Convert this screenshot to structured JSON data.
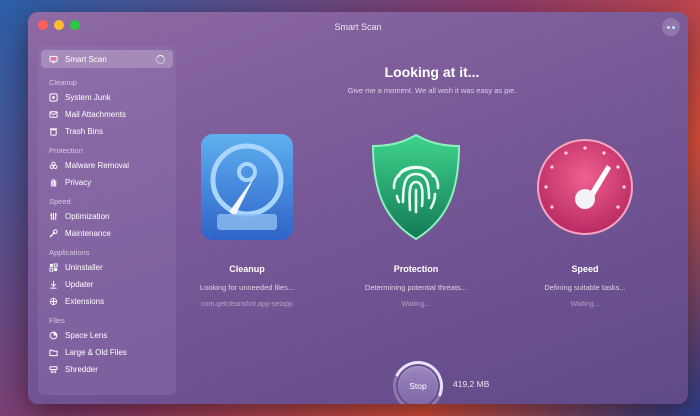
{
  "window": {
    "title": "Smart Scan"
  },
  "sidebar": {
    "active": {
      "label": "Smart Scan",
      "icon": "monitor-icon"
    },
    "sections": [
      {
        "label": "Cleanup",
        "items": [
          {
            "label": "System Junk",
            "icon": "junk-icon"
          },
          {
            "label": "Mail Attachments",
            "icon": "mail-icon"
          },
          {
            "label": "Trash Bins",
            "icon": "trash-icon"
          }
        ]
      },
      {
        "label": "Protection",
        "items": [
          {
            "label": "Malware Removal",
            "icon": "biohazard-icon"
          },
          {
            "label": "Privacy",
            "icon": "hand-icon"
          }
        ]
      },
      {
        "label": "Speed",
        "items": [
          {
            "label": "Optimization",
            "icon": "sliders-icon"
          },
          {
            "label": "Maintenance",
            "icon": "wrench-icon"
          }
        ]
      },
      {
        "label": "Applications",
        "items": [
          {
            "label": "Uninstaller",
            "icon": "uninstaller-icon"
          },
          {
            "label": "Updater",
            "icon": "updater-icon"
          },
          {
            "label": "Extensions",
            "icon": "extensions-icon"
          }
        ]
      },
      {
        "label": "Files",
        "items": [
          {
            "label": "Space Lens",
            "icon": "space-lens-icon"
          },
          {
            "label": "Large & Old Files",
            "icon": "folder-icon"
          },
          {
            "label": "Shredder",
            "icon": "shredder-icon"
          }
        ]
      }
    ]
  },
  "main": {
    "headline": "Looking at it...",
    "subline": "Give me a moment. We all wish it was easy as pie.",
    "modules": [
      {
        "title": "Cleanup",
        "status": "Looking for unneeded files...",
        "detail": "com.getcleanshot.app-setapp"
      },
      {
        "title": "Protection",
        "status": "Determining potential threats...",
        "detail": "Waiting..."
      },
      {
        "title": "Speed",
        "status": "Defining suitable tasks...",
        "detail": "Waiting..."
      }
    ]
  },
  "footer": {
    "stop_label": "Stop",
    "size": "419,2 MB"
  },
  "colors": {
    "accent": "#7d67a6",
    "shield": "#1f9d6a",
    "gauge": "#e0457a",
    "drive": "#3b7fd8"
  }
}
